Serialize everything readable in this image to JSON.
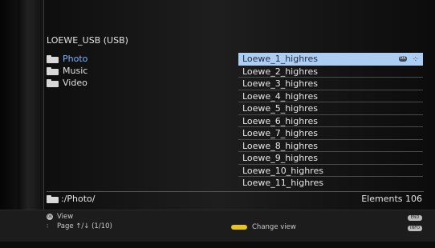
{
  "source": {
    "title": "LOEWE_USB (USB)"
  },
  "folders": [
    {
      "label": "Photo"
    },
    {
      "label": "Music"
    },
    {
      "label": "Video"
    }
  ],
  "files": [
    {
      "label": "Loewe_1_highres"
    },
    {
      "label": "Loewe_2_highres"
    },
    {
      "label": "Loewe_3_highres"
    },
    {
      "label": "Loewe_4_highres"
    },
    {
      "label": "Loewe_5_highres"
    },
    {
      "label": "Loewe_6_highres"
    },
    {
      "label": "Loewe_7_highres"
    },
    {
      "label": "Loewe_8_highres"
    },
    {
      "label": "Loewe_9_highres"
    },
    {
      "label": "Loewe_10_highres"
    },
    {
      "label": "Loewe_11_highres"
    }
  ],
  "selected_file_badge": {
    "ok": "OK",
    "nav": "⁘"
  },
  "footer": {
    "path": ":/Photo/",
    "elements": "Elements 106"
  },
  "hints": {
    "ok_key": "OK",
    "view": "View",
    "page": "Page ↑/↓ (1/10)",
    "change_view": "Change view",
    "end_key": "END",
    "info_key": "INFO"
  },
  "colors": {
    "selected_folder": "#7fb3ff",
    "selected_file_bg": "#aecdf2",
    "yellow_key": "#e6c51f"
  }
}
